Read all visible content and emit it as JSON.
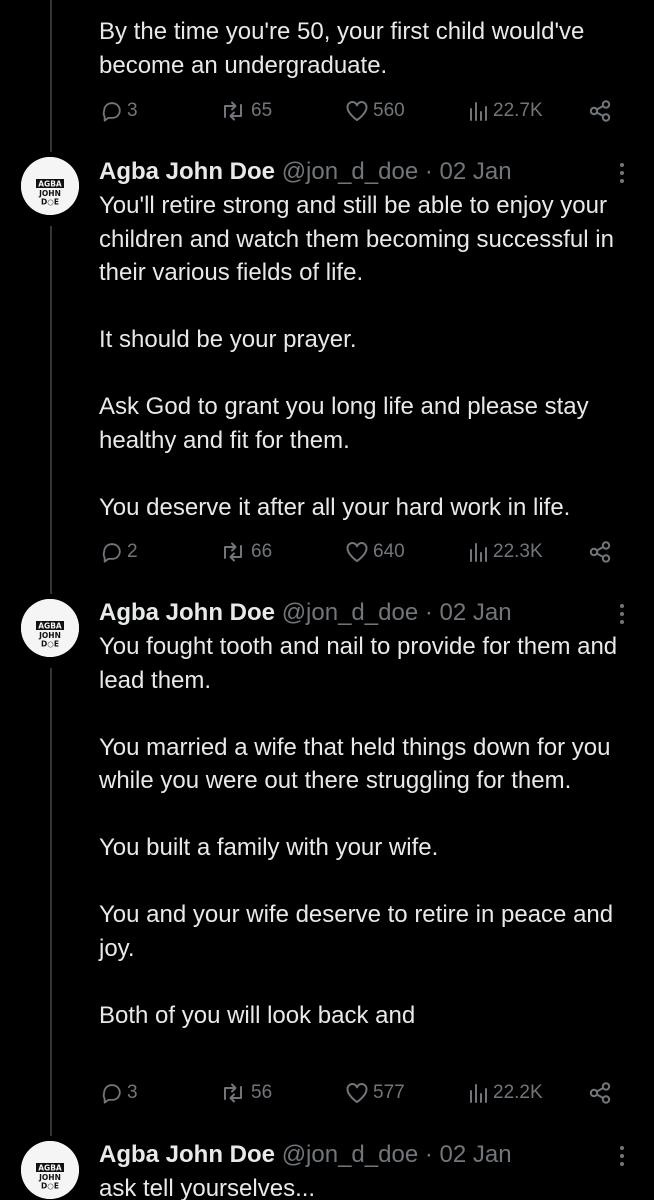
{
  "tweets": [
    {
      "show_header": false,
      "text": "By the time you're 50, your first child would've become an undergraduate.",
      "stats": {
        "replies": "3",
        "reposts": "65",
        "likes": "560",
        "views": "22.7K"
      }
    },
    {
      "show_header": true,
      "name": "Agba John Doe",
      "handle": "@jon_d_doe",
      "separator": "·",
      "date": "02 Jan",
      "text": "You'll retire strong and still be able to enjoy your children and watch them becoming successful in their various fields of life.\n\nIt should be your prayer.\n\nAsk God to grant you long life and please stay healthy and fit for them.\n\nYou deserve it after all your hard work in life.",
      "stats": {
        "replies": "2",
        "reposts": "66",
        "likes": "640",
        "views": "22.3K"
      }
    },
    {
      "show_header": true,
      "name": "Agba John Doe",
      "handle": "@jon_d_doe",
      "separator": "·",
      "date": "02 Jan",
      "text": "You fought tooth and nail to provide for them and lead them.\n\nYou married a wife that held things down for you while you were out there struggling for them.\n\nYou built a family with your wife.\n\nYou and your wife deserve to retire in peace and joy.\n\nBoth of you will look back and",
      "stats": {
        "replies": "3",
        "reposts": "56",
        "likes": "577",
        "views": "22.2K"
      }
    },
    {
      "show_header": true,
      "name": "Agba John Doe",
      "handle": "@jon_d_doe",
      "separator": "·",
      "date": "02 Jan",
      "text": "ask tell yourselves...",
      "stats": null
    }
  ],
  "avatar_logo": {
    "line1": "AGBA",
    "line2": "JOHN",
    "line3": "DOE"
  },
  "icons": {
    "reply": "reply-icon",
    "repost": "repost-icon",
    "like": "heart-icon",
    "views": "analytics-icon",
    "share": "share-icon",
    "more": "more-vertical-icon"
  },
  "colors": {
    "background": "#000000",
    "text": "#e7e9ea",
    "muted": "#71767b",
    "thread_line": "#333639"
  }
}
